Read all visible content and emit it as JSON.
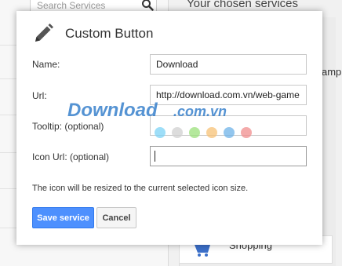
{
  "background": {
    "search_placeholder": "Search Services",
    "right_panel_title": "Your chosen services",
    "right_partial_text": "amp",
    "shopping_label": "Shopping"
  },
  "dialog": {
    "title": "Custom Button",
    "fields": [
      {
        "label": "Name:",
        "value": "Download"
      },
      {
        "label": "Url:",
        "value": "http://download.com.vn/web-game"
      },
      {
        "label": "Tooltip: (optional)",
        "value": ""
      },
      {
        "label": "Icon Url: (optional)",
        "value": ""
      }
    ],
    "note": "The icon will be resized to the current selected icon size.",
    "save_label": "Save service",
    "cancel_label": "Cancel"
  },
  "watermark": {
    "text": "Download",
    "suffix": ".com.vn",
    "dot_colors": [
      "#7dd3f5",
      "#d0d0d0",
      "#9be07b",
      "#f7c276",
      "#6fb3e8",
      "#f08e8e"
    ]
  },
  "colors": {
    "primary_button": "#4d90fe",
    "watermark_blue": "#2a78c8"
  }
}
